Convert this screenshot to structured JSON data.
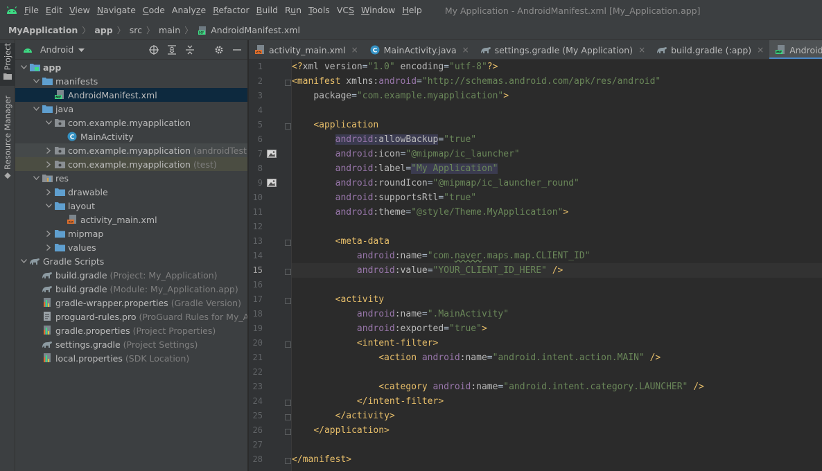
{
  "menubar": {
    "items": [
      "File",
      "Edit",
      "View",
      "Navigate",
      "Code",
      "Analyze",
      "Refactor",
      "Build",
      "Run",
      "Tools",
      "VCS",
      "Window",
      "Help"
    ],
    "mnemonic_letters": [
      "F",
      "E",
      "V",
      "N",
      "C",
      "z",
      "R",
      "B",
      "u",
      "T",
      "S",
      "W",
      "H"
    ],
    "window_title": "My Application - AndroidManifest.xml [My_Application.app]"
  },
  "breadcrumb": {
    "items": [
      "MyApplication",
      "app",
      "src",
      "main",
      "AndroidManifest.xml"
    ]
  },
  "toolstrip": {
    "project_label": "Project",
    "resource_manager_label": "Resource Manager"
  },
  "project_panel": {
    "view_label": "Android",
    "tree": [
      {
        "label": "app",
        "hint": "",
        "icon": "module-folder-icon",
        "depth": 0,
        "arrow": "open",
        "bold": true
      },
      {
        "label": "manifests",
        "hint": "",
        "icon": "folder-icon",
        "depth": 1,
        "arrow": "open"
      },
      {
        "label": "AndroidManifest.xml",
        "hint": "",
        "icon": "manifest-file-icon",
        "depth": 2,
        "arrow": "none",
        "selected": true
      },
      {
        "label": "java",
        "hint": "",
        "icon": "folder-icon",
        "depth": 1,
        "arrow": "open"
      },
      {
        "label": "com.example.myapplication",
        "hint": "",
        "icon": "package-icon",
        "depth": 2,
        "arrow": "open"
      },
      {
        "label": "MainActivity",
        "hint": "",
        "icon": "class-icon",
        "depth": 3,
        "arrow": "none"
      },
      {
        "label": "com.example.myapplication",
        "hint": "(androidTest)",
        "icon": "package-icon",
        "depth": 2,
        "arrow": "closed",
        "tinted": true
      },
      {
        "label": "com.example.myapplication",
        "hint": "(test)",
        "icon": "package-icon",
        "depth": 2,
        "arrow": "closed",
        "tinted2": true
      },
      {
        "label": "res",
        "hint": "",
        "icon": "res-folder-icon",
        "depth": 1,
        "arrow": "open"
      },
      {
        "label": "drawable",
        "hint": "",
        "icon": "folder-icon",
        "depth": 2,
        "arrow": "closed"
      },
      {
        "label": "layout",
        "hint": "",
        "icon": "folder-icon",
        "depth": 2,
        "arrow": "open"
      },
      {
        "label": "activity_main.xml",
        "hint": "",
        "icon": "layout-file-icon",
        "depth": 3,
        "arrow": "none"
      },
      {
        "label": "mipmap",
        "hint": "",
        "icon": "folder-icon",
        "depth": 2,
        "arrow": "closed"
      },
      {
        "label": "values",
        "hint": "",
        "icon": "folder-icon",
        "depth": 2,
        "arrow": "closed"
      },
      {
        "label": "Gradle Scripts",
        "hint": "",
        "icon": "gradle-icon",
        "depth": 0,
        "arrow": "open"
      },
      {
        "label": "build.gradle",
        "hint": "(Project: My_Application)",
        "icon": "gradle-icon",
        "depth": 1,
        "arrow": "none"
      },
      {
        "label": "build.gradle",
        "hint": "(Module: My_Application.app)",
        "icon": "gradle-icon",
        "depth": 1,
        "arrow": "none"
      },
      {
        "label": "gradle-wrapper.properties",
        "hint": "(Gradle Version)",
        "icon": "properties-icon",
        "depth": 1,
        "arrow": "none"
      },
      {
        "label": "proguard-rules.pro",
        "hint": "(ProGuard Rules for My_Applica",
        "icon": "text-file-icon",
        "depth": 1,
        "arrow": "none"
      },
      {
        "label": "gradle.properties",
        "hint": "(Project Properties)",
        "icon": "properties-icon",
        "depth": 1,
        "arrow": "none"
      },
      {
        "label": "settings.gradle",
        "hint": "(Project Settings)",
        "icon": "gradle-icon",
        "depth": 1,
        "arrow": "none"
      },
      {
        "label": "local.properties",
        "hint": "(SDK Location)",
        "icon": "properties-icon",
        "depth": 1,
        "arrow": "none"
      }
    ]
  },
  "tabs": [
    {
      "label": "activity_main.xml",
      "icon": "layout-file-icon",
      "active": false
    },
    {
      "label": "MainActivity.java",
      "icon": "class-icon",
      "active": false
    },
    {
      "label": "settings.gradle (My Application)",
      "icon": "gradle-icon",
      "active": false
    },
    {
      "label": "build.gradle (:app)",
      "icon": "gradle-icon",
      "active": false
    },
    {
      "label": "AndroidManifest.xml",
      "icon": "manifest-file-icon",
      "active": true
    }
  ],
  "tab_close_glyph": "×",
  "editor": {
    "current_line": 15,
    "lines": [
      [
        [
          "t-pi",
          "<?"
        ],
        [
          "t-attr",
          "xml version"
        ],
        [
          "",
          "="
        ],
        [
          "t-val",
          "\"1.0\""
        ],
        [
          "t-attr",
          " encoding"
        ],
        [
          "",
          "="
        ],
        [
          "t-val",
          "\"utf-8\""
        ],
        [
          "t-pi",
          "?>"
        ]
      ],
      [
        [
          "t-tag",
          "<manifest "
        ],
        [
          "t-attr",
          "xmlns:"
        ],
        [
          "t-ns",
          "android"
        ],
        [
          "",
          "="
        ],
        [
          "t-val",
          "\"http://schemas.android.com/apk/res/android\""
        ]
      ],
      [
        [
          "",
          "    "
        ],
        [
          "t-attr",
          "package"
        ],
        [
          "",
          "="
        ],
        [
          "t-val",
          "\"com.example.myapplication\""
        ],
        [
          "t-tag",
          ">"
        ]
      ],
      [],
      [
        [
          "",
          "    "
        ],
        [
          "t-tag",
          "<application"
        ]
      ],
      [
        [
          "",
          "        "
        ],
        [
          "t-ns hl-ns",
          "android"
        ],
        [
          "t-attr hl-ns",
          ":allowBackup"
        ],
        [
          "",
          "="
        ],
        [
          "t-val",
          "\"true\""
        ]
      ],
      [
        [
          "",
          "        "
        ],
        [
          "t-ns",
          "android"
        ],
        [
          "t-attr",
          ":icon"
        ],
        [
          "",
          "="
        ],
        [
          "t-val",
          "\"@mipmap/ic_launcher\""
        ]
      ],
      [
        [
          "",
          "        "
        ],
        [
          "t-ns",
          "android"
        ],
        [
          "t-attr",
          ":label"
        ],
        [
          "",
          "="
        ],
        [
          "t-val hl-ns",
          "\"My Application\""
        ]
      ],
      [
        [
          "",
          "        "
        ],
        [
          "t-ns",
          "android"
        ],
        [
          "t-attr",
          ":roundIcon"
        ],
        [
          "",
          "="
        ],
        [
          "t-val",
          "\"@mipmap/ic_launcher_round\""
        ]
      ],
      [
        [
          "",
          "        "
        ],
        [
          "t-ns",
          "android"
        ],
        [
          "t-attr",
          ":supportsRtl"
        ],
        [
          "",
          "="
        ],
        [
          "t-val",
          "\"true\""
        ]
      ],
      [
        [
          "",
          "        "
        ],
        [
          "t-ns",
          "android"
        ],
        [
          "t-attr",
          ":theme"
        ],
        [
          "",
          "="
        ],
        [
          "t-val",
          "\"@style/Theme.MyApplication\""
        ],
        [
          "t-tag",
          ">"
        ]
      ],
      [],
      [
        [
          "",
          "        "
        ],
        [
          "t-tag",
          "<meta-data"
        ]
      ],
      [
        [
          "",
          "            "
        ],
        [
          "t-ns",
          "android"
        ],
        [
          "t-attr",
          ":name"
        ],
        [
          "",
          "="
        ],
        [
          "t-val",
          "\"com."
        ],
        [
          "t-val squiggle",
          "naver"
        ],
        [
          "t-val",
          ".maps.map.CLIENT_ID\""
        ]
      ],
      [
        [
          "",
          "            "
        ],
        [
          "t-ns",
          "android"
        ],
        [
          "t-attr",
          ":value"
        ],
        [
          "",
          "="
        ],
        [
          "t-val",
          "\"YOUR_CLIENT_ID_HERE\""
        ],
        [
          "t-tag",
          " />"
        ]
      ],
      [],
      [
        [
          "",
          "        "
        ],
        [
          "t-tag",
          "<activity"
        ]
      ],
      [
        [
          "",
          "            "
        ],
        [
          "t-ns",
          "android"
        ],
        [
          "t-attr",
          ":name"
        ],
        [
          "",
          "="
        ],
        [
          "t-val",
          "\".MainActivity\""
        ]
      ],
      [
        [
          "",
          "            "
        ],
        [
          "t-ns",
          "android"
        ],
        [
          "t-attr",
          ":exported"
        ],
        [
          "",
          "="
        ],
        [
          "t-val",
          "\"true\""
        ],
        [
          "t-tag",
          ">"
        ]
      ],
      [
        [
          "",
          "            "
        ],
        [
          "t-tag",
          "<intent-filter>"
        ]
      ],
      [
        [
          "",
          "                "
        ],
        [
          "t-tag",
          "<action "
        ],
        [
          "t-ns",
          "android"
        ],
        [
          "t-attr",
          ":name"
        ],
        [
          "",
          "="
        ],
        [
          "t-val",
          "\"android.intent.action.MAIN\""
        ],
        [
          "t-tag",
          " />"
        ]
      ],
      [],
      [
        [
          "",
          "                "
        ],
        [
          "t-tag",
          "<category "
        ],
        [
          "t-ns",
          "android"
        ],
        [
          "t-attr",
          ":name"
        ],
        [
          "",
          "="
        ],
        [
          "t-val",
          "\"android.intent.category.LAUNCHER\""
        ],
        [
          "t-tag",
          " />"
        ]
      ],
      [
        [
          "",
          "            "
        ],
        [
          "t-tag",
          "</intent-filter>"
        ]
      ],
      [
        [
          "",
          "        "
        ],
        [
          "t-tag",
          "</activity>"
        ]
      ],
      [
        [
          "",
          "    "
        ],
        [
          "t-tag",
          "</application>"
        ]
      ],
      [],
      [
        [
          "t-tag",
          "</manifest>"
        ]
      ]
    ],
    "gutter_icons": [
      {
        "line": 7,
        "icon": "image-icon"
      },
      {
        "line": 9,
        "icon": "image-icon"
      }
    ],
    "fold_markers": [
      2,
      5,
      13,
      15,
      17,
      20,
      24,
      25,
      26,
      28
    ]
  },
  "colors": {
    "accent": "#4a88c7",
    "android_green": "#3ddc84",
    "folder_blue": "#5f9fcf",
    "selection": "#0d293e"
  }
}
